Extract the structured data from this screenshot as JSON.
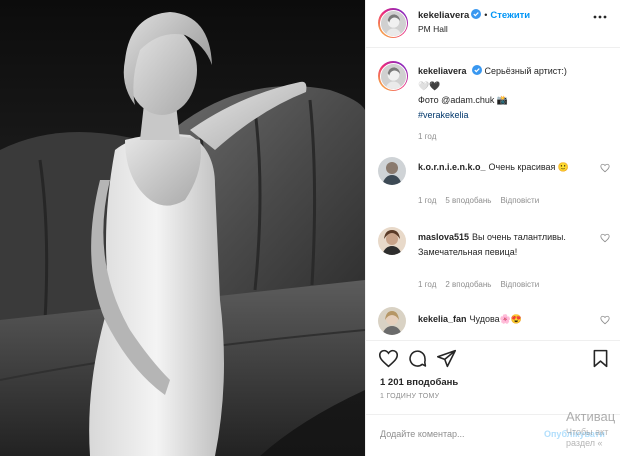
{
  "header": {
    "username": "kekeliavera",
    "follow_label": "Стежити",
    "separator": "•",
    "location": "PM Hall"
  },
  "caption": {
    "username": "kekeliavera",
    "line1": "Серьёзный артист:)",
    "line2": "🤍🖤",
    "line3": "Фото @adam.chuk 📸",
    "line4": "#verakekelia",
    "age": "1 год"
  },
  "comments": [
    {
      "username": "k.o.r.n.i.e.n.k.o_",
      "text": "Очень красивая 🙂",
      "age": "1 год",
      "likes": "5 вподобань",
      "reply_label": "Відповісти"
    },
    {
      "username": "maslova515",
      "text": "Вы очень талантливы. Замечательная певица!",
      "age": "1 год",
      "likes": "2 вподобань",
      "reply_label": "Відповісти"
    },
    {
      "username": "kekelia_fan",
      "text": "Чудова🌸😍"
    }
  ],
  "likes_label": "1 201 вподобань",
  "time_label": "1 ГОДИНУ ТОМУ",
  "add_comment": {
    "placeholder": "Додайте коментар...",
    "post_label": "Опублікувати"
  },
  "watermark": {
    "line1": "Активац",
    "line2": "Чтобы акт",
    "line3": "раздел «"
  },
  "colors": {
    "accent": "#0095f6",
    "muted": "#8e8e8e",
    "text": "#262626"
  }
}
